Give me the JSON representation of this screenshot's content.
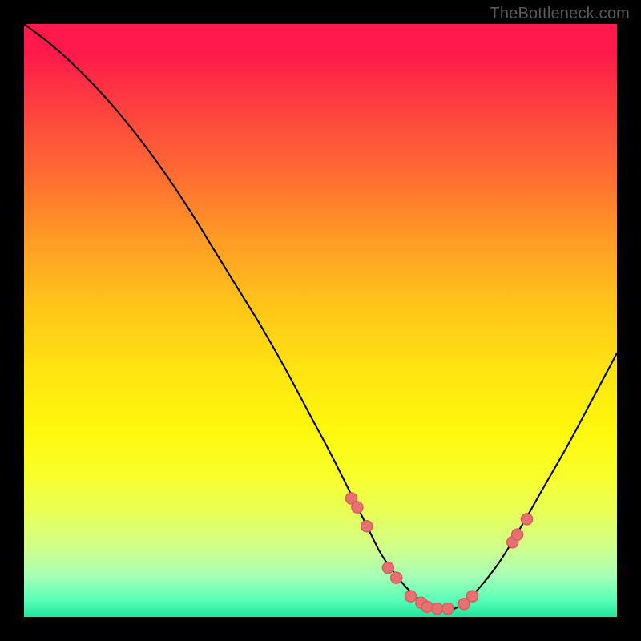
{
  "watermark": "TheBottleneck.com",
  "colors": {
    "dot": "#e77070",
    "curve": "#000000",
    "frame": "#000000"
  },
  "chart_data": {
    "type": "line",
    "title": "",
    "xlabel": "",
    "ylabel": "",
    "xlim": [
      0,
      100
    ],
    "ylim": [
      0,
      100
    ],
    "note": "Axes not labeled in source; values are percent of plot area (x left→right, y value where 0=bottom,100=top). Curve estimated from pixels.",
    "series": [
      {
        "name": "bottleneck-curve",
        "x": [
          0,
          4,
          8,
          12,
          16,
          20,
          24,
          28,
          32,
          36,
          40,
          44,
          48,
          52,
          56,
          58,
          60,
          62,
          64,
          66,
          68,
          70,
          72,
          74,
          76,
          80,
          84,
          88,
          92,
          96,
          100
        ],
        "y": [
          100,
          97,
          93.5,
          89.5,
          85,
          80,
          74.5,
          68.5,
          62,
          55.5,
          49,
          42,
          34.5,
          27,
          19,
          15,
          11,
          8,
          5.5,
          3.5,
          2,
          1.2,
          1.2,
          2.2,
          4,
          9,
          15.5,
          22.5,
          29.5,
          37,
          44.5
        ]
      }
    ],
    "markers": {
      "name": "highlight-dots",
      "x": [
        55.2,
        56.2,
        57.8,
        61.4,
        62.8,
        65.2,
        67.0,
        68.0,
        69.7,
        71.5,
        74.2,
        75.6,
        82.4,
        83.2,
        84.8
      ],
      "y": [
        20.0,
        18.5,
        15.3,
        8.3,
        6.6,
        3.5,
        2.4,
        1.7,
        1.4,
        1.4,
        2.2,
        3.5,
        12.6,
        13.9,
        16.5
      ]
    }
  }
}
